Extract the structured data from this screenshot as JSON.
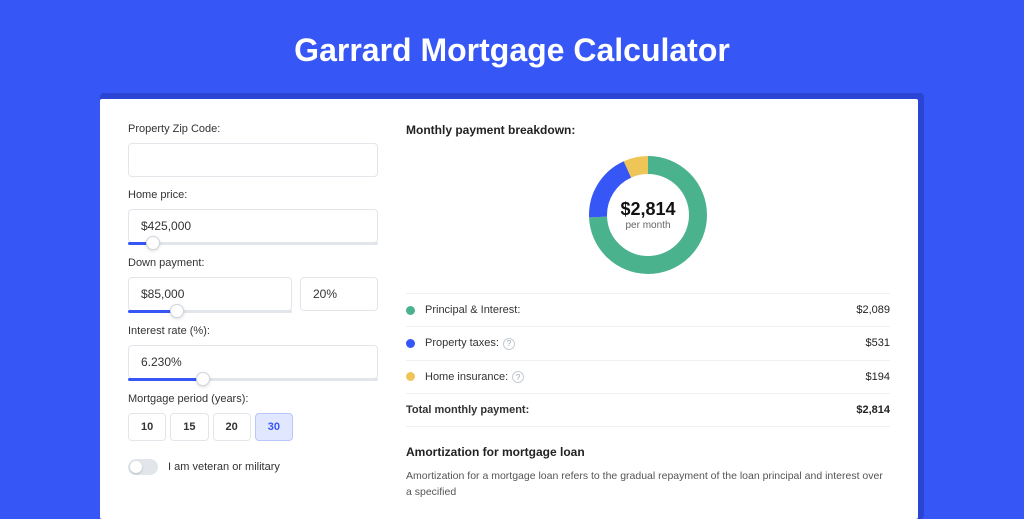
{
  "title": "Garrard Mortgage Calculator",
  "form": {
    "zip": {
      "label": "Property Zip Code:",
      "value": ""
    },
    "home_price": {
      "label": "Home price:",
      "value": "$425,000",
      "slider_pct": 10
    },
    "down_payment": {
      "label": "Down payment:",
      "value": "$85,000",
      "pct_value": "20%",
      "slider_pct": 20
    },
    "interest_rate": {
      "label": "Interest rate (%):",
      "value": "6.230%",
      "slider_pct": 30
    },
    "mortgage_period": {
      "label": "Mortgage period (years):",
      "options": [
        "10",
        "15",
        "20",
        "30"
      ],
      "selected": "30"
    },
    "veteran": {
      "label": "I am veteran or military",
      "checked": false
    }
  },
  "breakdown": {
    "title": "Monthly payment breakdown:",
    "center_amount": "$2,814",
    "center_sub": "per month",
    "items": [
      {
        "color": "green",
        "label": "Principal & Interest:",
        "value": "$2,089",
        "help": false
      },
      {
        "color": "blue",
        "label": "Property taxes:",
        "value": "$531",
        "help": true
      },
      {
        "color": "yellow",
        "label": "Home insurance:",
        "value": "$194",
        "help": true
      }
    ],
    "total": {
      "label": "Total monthly payment:",
      "value": "$2,814"
    }
  },
  "chart_data": {
    "type": "pie",
    "title": "Monthly payment breakdown",
    "series": [
      {
        "name": "Principal & Interest",
        "value": 2089,
        "color": "#4bb28e"
      },
      {
        "name": "Property taxes",
        "value": 531,
        "color": "#3656f5"
      },
      {
        "name": "Home insurance",
        "value": 194,
        "color": "#f0c558"
      }
    ],
    "total": 2814
  },
  "amortization": {
    "title": "Amortization for mortgage loan",
    "text": "Amortization for a mortgage loan refers to the gradual repayment of the loan principal and interest over a specified"
  }
}
